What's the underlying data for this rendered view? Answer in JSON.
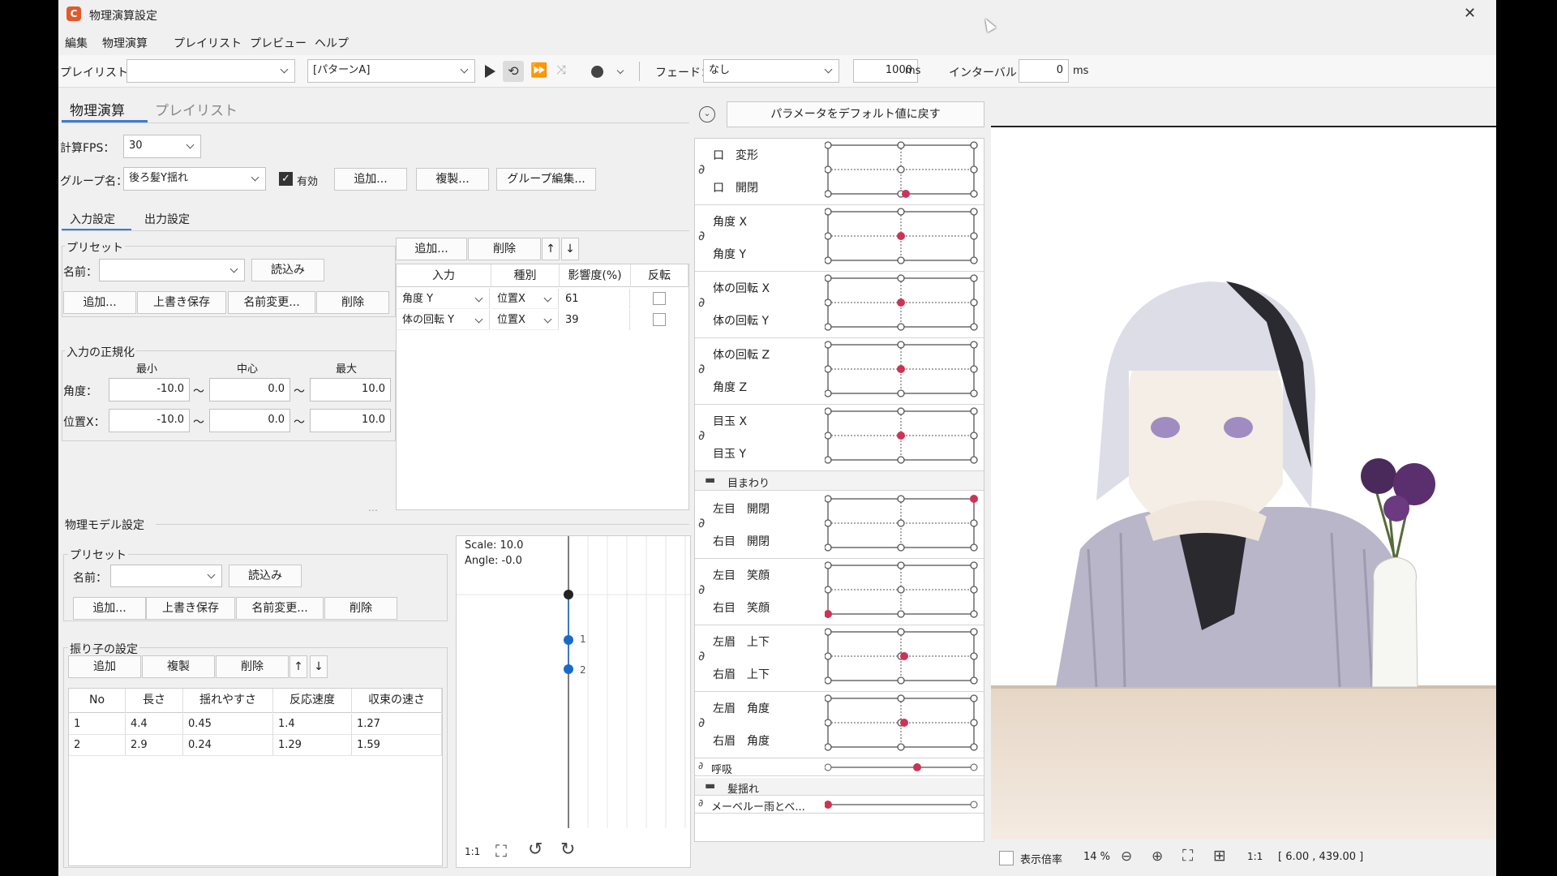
{
  "window": {
    "title": "物理演算設定",
    "close": "✕"
  },
  "menu": [
    "編集",
    "物理演算",
    "プレイリスト",
    "プレビュー",
    "ヘルプ"
  ],
  "toolbar": {
    "playlist_label": "プレイリスト：",
    "playlist_value": "",
    "pattern_value": "[パターンA]",
    "fade_label": "フェード：",
    "fade_value": "なし",
    "fade_ms": "1000",
    "ms1": "ms",
    "interval_label": "インターバル：",
    "interval_value": "0",
    "ms2": "ms"
  },
  "tabs": [
    "物理演算",
    "プレイリスト"
  ],
  "fps": {
    "label": "計算FPS：",
    "value": "30"
  },
  "group": {
    "label": "グループ名：",
    "value": "後ろ髪Y揺れ",
    "enabled_label": "有効",
    "add": "追加...",
    "copy": "複製...",
    "edit": "グループ編集..."
  },
  "subtabs": [
    "入力設定",
    "出力設定"
  ],
  "preset": {
    "title": "プリセット",
    "name_label": "名前：",
    "name_value": "",
    "load": "読込み",
    "add": "追加...",
    "overwrite": "上書き保存",
    "rename": "名前変更...",
    "delete": "削除"
  },
  "inputs": {
    "add": "追加...",
    "delete": "削除",
    "up": "↑",
    "down": "↓",
    "headers": [
      "入力",
      "種別",
      "影響度(%)",
      "反転"
    ],
    "rows": [
      {
        "input": "角度 Y",
        "type": "位置X",
        "weight": "61"
      },
      {
        "input": "体の回転 Y",
        "type": "位置X",
        "weight": "39"
      }
    ]
  },
  "normalize": {
    "title": "入力の正規化",
    "min": "最小",
    "center": "中心",
    "max": "最大",
    "tilde": "〜",
    "rows": [
      {
        "label": "角度：",
        "min": "-10.0",
        "center": "0.0",
        "max": "10.0"
      },
      {
        "label": "位置X：",
        "min": "-10.0",
        "center": "0.0",
        "max": "10.0"
      }
    ]
  },
  "model": {
    "title": "物理モデル設定",
    "preset_title": "プリセット",
    "name_label": "名前：",
    "load": "読込み",
    "add": "追加...",
    "overwrite": "上書き保存",
    "rename": "名前変更...",
    "delete": "削除",
    "pendulum_title": "振り子の設定",
    "p_add": "追加",
    "p_copy": "複製",
    "p_delete": "削除",
    "up": "↑",
    "down": "↓",
    "headers": [
      "No",
      "長さ",
      "揺れやすさ",
      "反応速度",
      "収束の速さ"
    ],
    "rows": [
      [
        "1",
        "4.4",
        "0.45",
        "1.4",
        "1.27"
      ],
      [
        "2",
        "2.9",
        "0.24",
        "1.29",
        "1.59"
      ]
    ]
  },
  "pendulum_view": {
    "scale": "Scale: 10.0",
    "angle": "Angle: -0.0",
    "label1": "1",
    "label2": "2",
    "ratio": "1:1"
  },
  "params": {
    "reset": "パラメータをデフォルト値に戻す",
    "pairs": [
      [
        "口　変形",
        "口　開閉"
      ],
      [
        "角度 X",
        "角度 Y"
      ],
      [
        "体の回転 X",
        "体の回転 Y"
      ],
      [
        "体の回転 Z",
        "角度 Z"
      ],
      [
        "目玉 X",
        "目玉 Y"
      ]
    ],
    "folder1": "目まわり",
    "pairs2": [
      [
        "左目　開閉",
        "右目　開閉"
      ],
      [
        "左目　笑顔",
        "右目　笑顔"
      ],
      [
        "左眉　上下",
        "右眉　上下"
      ],
      [
        "左眉　角度",
        "右眉　角度"
      ]
    ],
    "breath": "呼吸",
    "folder2": "髪揺れ",
    "hair": "メーベルー雨とべ..."
  },
  "preview": {
    "zoom_label": "表示倍率",
    "zoom_value": "14 %",
    "ratio": "1:1",
    "coords": "[ 6.00 , 439.00 ]"
  },
  "colors": {
    "accent": "#cc3355",
    "pendulum_node": "#1a6bc8",
    "brand": "#e05a2b"
  }
}
